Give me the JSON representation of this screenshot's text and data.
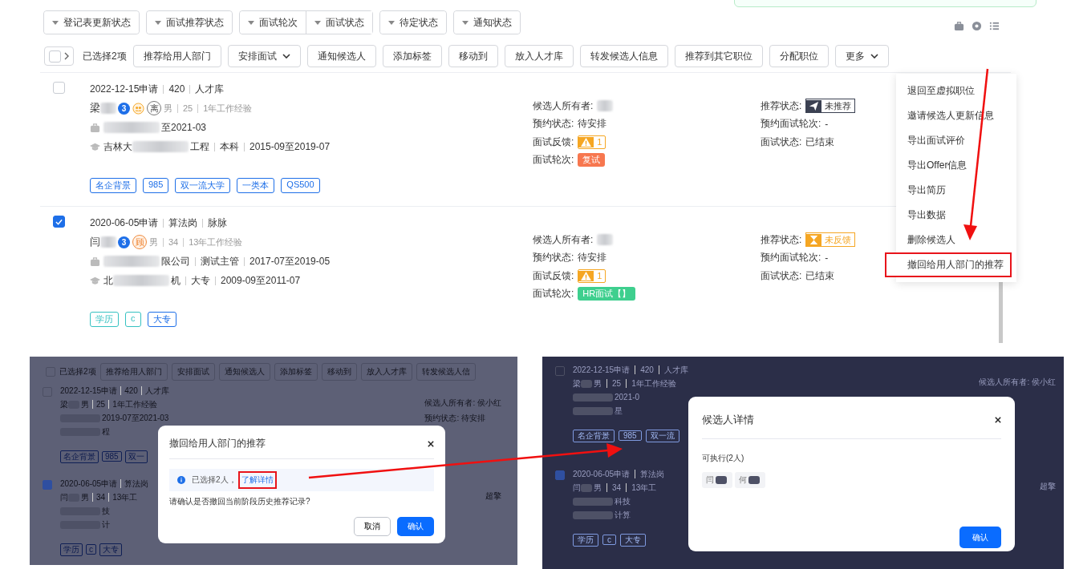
{
  "filters": [
    [
      "登记表更新状态"
    ],
    [
      "面试推荐状态"
    ],
    [
      "面试轮次",
      "面试状态"
    ],
    [
      "待定状态"
    ],
    [
      "通知状态"
    ]
  ],
  "toolbar": {
    "select_all_checked": false,
    "selected_count": "已选择2项",
    "actions": [
      {
        "label": "推荐给用人部门",
        "dropdown": false
      },
      {
        "label": "安排面试",
        "dropdown": true
      },
      {
        "label": "通知候选人",
        "dropdown": false
      },
      {
        "label": "添加标签",
        "dropdown": false
      },
      {
        "label": "移动到",
        "dropdown": false
      },
      {
        "label": "放入人才库",
        "dropdown": false
      },
      {
        "label": "转发候选人信息",
        "dropdown": false
      },
      {
        "label": "推荐到其它职位",
        "dropdown": false
      },
      {
        "label": "分配职位",
        "dropdown": false
      },
      {
        "label": "更多",
        "dropdown": true
      }
    ]
  },
  "candidates": [
    {
      "checked": false,
      "header": [
        "2022-12-15申请",
        "420",
        "人才库"
      ],
      "name": "梁",
      "marks": [
        {
          "kind": "count",
          "text": "3"
        },
        {
          "kind": "people"
        },
        {
          "kind": "char",
          "text": "离"
        }
      ],
      "meta": [
        "男",
        "25",
        "1年工作经验"
      ],
      "work": {
        "post": "至2021-03"
      },
      "edu": {
        "pre": "吉林大",
        "post": "工程",
        "fields": [
          "本科",
          "2015-09至2019-07"
        ]
      },
      "tags": [
        {
          "text": "名企背景",
          "color": "#1e6fe8"
        },
        {
          "text": "985",
          "color": "#1e6fe8"
        },
        {
          "text": "双一流大学",
          "color": "#1e6fe8"
        },
        {
          "text": "一类本",
          "color": "#1e6fe8"
        },
        {
          "text": "QS500",
          "color": "#1e6fe8"
        }
      ],
      "owner_label": "候选人所有者:",
      "booking": {
        "label": "预约状态:",
        "value": "待安排"
      },
      "feedback": {
        "label": "面试反馈:",
        "count": "1"
      },
      "round": {
        "label": "面试轮次:",
        "text": "复试",
        "color": "#f7774f"
      },
      "recommend": {
        "label": "推荐状态:",
        "kind": "sent",
        "text": "未推荐"
      },
      "booked_round": {
        "label": "预约面试轮次:",
        "value": "-"
      },
      "interview_status": {
        "label": "面试状态:",
        "value": "已结束"
      }
    },
    {
      "checked": true,
      "header": [
        "2020-06-05申请",
        "算法岗",
        "脉脉"
      ],
      "name": "闫",
      "marks": [
        {
          "kind": "count",
          "text": "3"
        },
        {
          "kind": "char_orange",
          "text": "顾"
        }
      ],
      "meta": [
        "男",
        "34",
        "13年工作经验"
      ],
      "work": {
        "post": "限公司",
        "fields": [
          "测试主管",
          "2017-07至2019-05"
        ]
      },
      "edu": {
        "pre": "北",
        "post": "机",
        "fields": [
          "大专",
          "2009-09至2011-07"
        ]
      },
      "tags": [
        {
          "text": "学历",
          "color": "#36c2c2"
        },
        {
          "text": "c",
          "color": "#36c2c2"
        },
        {
          "text": "大专",
          "color": "#1e6fe8"
        }
      ],
      "owner_label": "候选人所有者:",
      "booking": {
        "label": "预约状态:",
        "value": "待安排"
      },
      "feedback": {
        "label": "面试反馈:",
        "count": "1"
      },
      "round": {
        "label": "面试轮次:",
        "text": "HR面试【】",
        "color": "#3ecf8e"
      },
      "recommend": {
        "label": "推荐状态:",
        "kind": "waiting",
        "text": "未反馈"
      },
      "booked_round": {
        "label": "预约面试轮次:",
        "value": "-"
      },
      "interview_status": {
        "label": "面试状态:",
        "value": "已结束"
      }
    }
  ],
  "more_menu": [
    {
      "label": "退回至虚拟职位",
      "highlighted": false
    },
    {
      "label": "邀请候选人更新信息",
      "highlighted": false
    },
    {
      "label": "导出面试评价",
      "highlighted": false
    },
    {
      "label": "导出Offer信息",
      "highlighted": false
    },
    {
      "label": "导出简历",
      "highlighted": false
    },
    {
      "label": "导出数据",
      "highlighted": false
    },
    {
      "label": "删除候选人",
      "highlighted": false
    },
    {
      "label": "撤回给用人部门的推荐",
      "highlighted": true
    }
  ],
  "withdraw_view": {
    "background": {
      "select_all_checked": false,
      "selected_count": "已选择2项",
      "actions": [
        "推荐给用人部门",
        "安排面试",
        "通知候选人",
        "添加标签",
        "移动到",
        "放入人才库",
        "转发候选人信"
      ],
      "rows": [
        {
          "checked": false,
          "header": [
            "2022-12-15申请",
            "420",
            "人才库"
          ],
          "name": "梁",
          "meta": [
            "男",
            "25",
            "1年工作经验"
          ],
          "work": "2019-07至2021-03",
          "edu": "程",
          "tags": [
            "名企背景",
            "985",
            "双一"
          ],
          "side": [
            "候选人所有者: 侯小红",
            "预约状态: 待安排"
          ]
        },
        {
          "checked": true,
          "header": [
            "2020-06-05申请",
            "算法岗"
          ],
          "name": "闫",
          "meta": [
            "男",
            "34",
            "13年工"
          ],
          "work": "技",
          "edu": "计",
          "tags": [
            "学历",
            "c",
            "大专"
          ],
          "side": [
            "超擎"
          ]
        }
      ]
    },
    "dialog": {
      "title": "撤回给用人部门的推荐",
      "info": "已选择2人，",
      "link": "了解详情",
      "link_framed": true,
      "question": "请确认是否撤回当前阶段历史推荐记录?",
      "cancel": "取消",
      "confirm": "确认"
    }
  },
  "details_view": {
    "background": {
      "rows": [
        {
          "checked": false,
          "header": [
            "2022-12-15申请",
            "420",
            "人才库"
          ],
          "name": "梁",
          "meta": [
            "男",
            "25",
            "1年工作经验"
          ],
          "work": "2021-0",
          "edu": "星",
          "tags": [
            "名企背景",
            "985",
            "双一流"
          ],
          "side": [
            "候选人所有者: 侯小红"
          ]
        },
        {
          "checked": true,
          "header": [
            "2020-06-05申请",
            "算法岗"
          ],
          "name": "闫",
          "meta": [
            "男",
            "34",
            "13年工"
          ],
          "work": "科技",
          "edu": "计算",
          "tags": [
            "学历",
            "c",
            "大专"
          ],
          "side": [
            "超擎"
          ]
        }
      ]
    },
    "dialog": {
      "title": "候选人详情",
      "section": "可执行(2人)",
      "people": [
        "闫",
        "何"
      ],
      "confirm": "确认"
    }
  }
}
